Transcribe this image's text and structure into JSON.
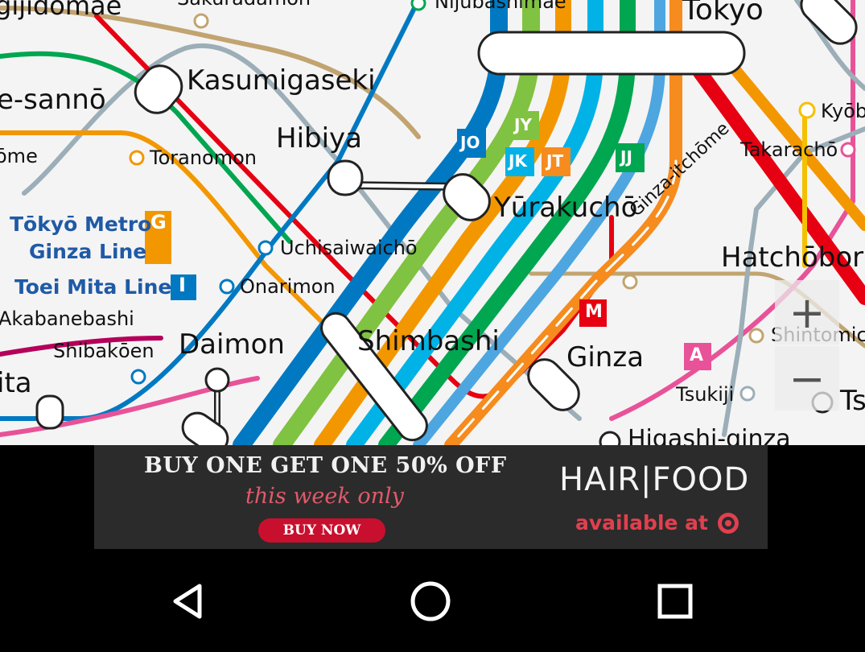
{
  "map": {
    "stations": {
      "nijubashimae": "Nijūbashimae",
      "sakuradamon": "Sakuradamon",
      "tokyo": "Tokyo",
      "kasumigaseki": "Kasumigaseki",
      "yamano_sanno": "e-sannō",
      "ome": "ōme",
      "toranomon": "Toranomon",
      "hibiya": "Hibiya",
      "kyobashi": "Kyōb",
      "takaracho": "Takarachō",
      "yurakucho": "Yūrakuchō",
      "ginza_itchome": "Ginza-itchōme",
      "uchisaiwaicho": "Uchisaiwaichō",
      "onarimon": "Onarimon",
      "hatchobori": "Hatchōbori",
      "akabanebashi": "Akabanebashi",
      "shibakoen": "Shibakōen",
      "daimon": "Daimon",
      "shimbashi": "Shimbashi",
      "ginza": "Ginza",
      "shintomicho": "Shintomic",
      "tsukiji": "Tsukiji",
      "ita": "ita",
      "higashi_ginza": "Higashi-ginza",
      "ts": "Ts",
      "jigidomae": "gijidomae"
    },
    "line_legend": [
      {
        "name_line1": "Tōkyō Metro",
        "name_line2": "Ginza Line",
        "badge": "G",
        "color": "#f39700"
      },
      {
        "name_line1": "Toei Mita Line",
        "badge": "I",
        "color": "#0079c2"
      }
    ],
    "badges": {
      "jo": "JO",
      "jy": "JY",
      "jk": "JK",
      "jt": "JT",
      "jj": "JJ",
      "m": "M",
      "a": "A"
    }
  },
  "zoom": {
    "in": "+",
    "out": "−"
  },
  "ad": {
    "headline": "BUY ONE GET ONE 50% OFF",
    "subline": "this week only",
    "button": "BUY NOW",
    "brand": "HAIR|FOOD",
    "availability": "available at",
    "colors": {
      "accent": "#c8102e",
      "background": "#2b2b2b"
    }
  },
  "navbar": {
    "back": "back-icon",
    "home": "home-icon",
    "recents": "recents-icon"
  },
  "colors": {
    "hanzomon": "#8f76d6",
    "marunouchi": "#e60012",
    "chiyoda": "#00a650",
    "ginza": "#f39700",
    "hibiya": "#9caeb7",
    "mita": "#0079c2",
    "asakusa": "#e85298",
    "namboku": "#00ada9",
    "yurakucho_line": "#c1a470",
    "jr_yamanote": "#80c241",
    "jr_keihin": "#00b2e5",
    "jr_chuo": "#f15a22",
    "jr_tokaido": "#f68b1e"
  }
}
